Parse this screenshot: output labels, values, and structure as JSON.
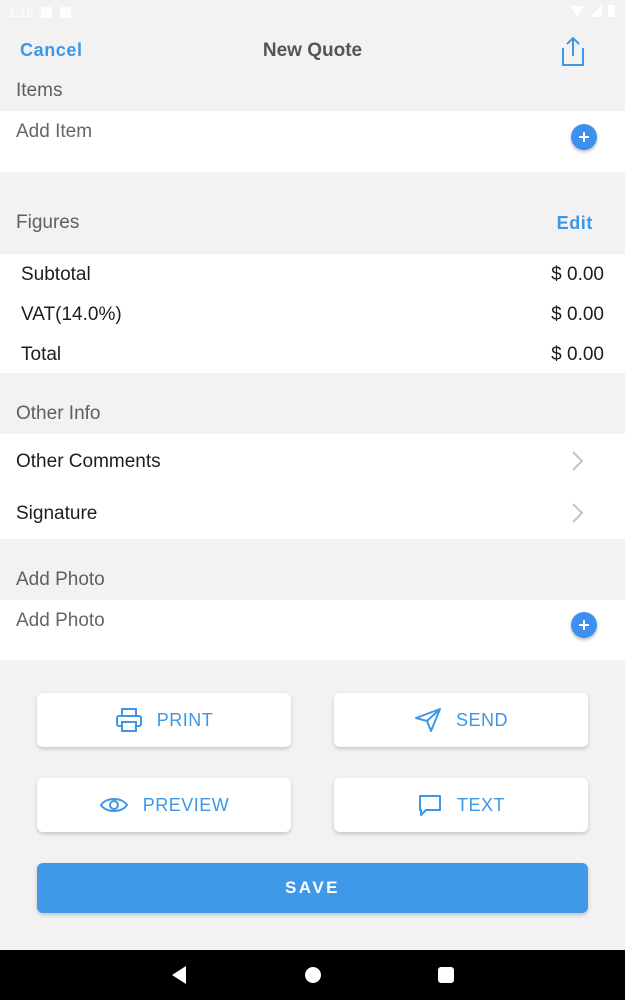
{
  "status_bar": {
    "time": "1:16"
  },
  "nav": {
    "cancel_label": "Cancel",
    "title": "New Quote",
    "share_icon": "share-icon"
  },
  "items": {
    "header": "Items",
    "add_item_label": "Add Item"
  },
  "figures": {
    "header": "Figures",
    "edit_label": "Edit",
    "rows": [
      {
        "label": "Subtotal",
        "value": "$ 0.00"
      },
      {
        "label": "VAT(14.0%)",
        "value": "$ 0.00"
      },
      {
        "label": "Total",
        "value": "$ 0.00"
      }
    ]
  },
  "other_info": {
    "header": "Other Info",
    "rows": [
      {
        "label": "Other Comments"
      },
      {
        "label": "Signature"
      }
    ]
  },
  "photo": {
    "header": "Add Photo",
    "add_photo_label": "Add Photo"
  },
  "actions": {
    "print_label": "PRINT",
    "send_label": "SEND",
    "preview_label": "PREVIEW",
    "text_label": "TEXT",
    "save_label": "SAVE"
  },
  "colors": {
    "accent": "#3d97e6",
    "save": "#3f99e8",
    "background": "#f2f2f3"
  }
}
